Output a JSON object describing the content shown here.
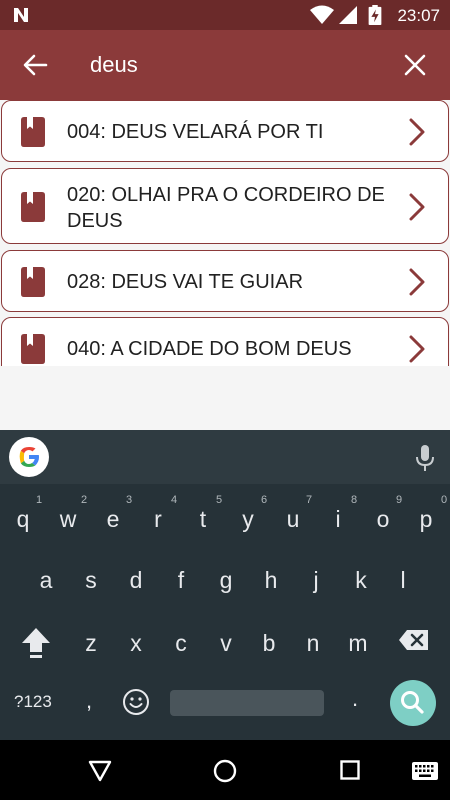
{
  "status_bar": {
    "time": "23:07",
    "icons": [
      "n-notification-icon",
      "wifi-icon",
      "signal-icon",
      "battery-charging-icon"
    ]
  },
  "app_bar": {
    "back_icon": "arrow-left-icon",
    "query": "deus",
    "clear_icon": "close-icon"
  },
  "results": [
    {
      "title": "004: DEUS VELARÁ POR TI"
    },
    {
      "title": "020: OLHAI PRA O CORDEIRO DE DEUS"
    },
    {
      "title": "028: DEUS VAI TE GUIAR"
    },
    {
      "title": "040: A CIDADE DO BOM DEUS"
    }
  ],
  "keyboard": {
    "row1": [
      "q",
      "w",
      "e",
      "r",
      "t",
      "y",
      "u",
      "i",
      "o",
      "p"
    ],
    "row1_hints": [
      "",
      "1",
      "2",
      "3",
      "4",
      "5",
      "6",
      "7",
      "8",
      "9",
      "0"
    ],
    "row2": [
      "a",
      "s",
      "d",
      "f",
      "g",
      "h",
      "j",
      "k",
      "l"
    ],
    "row3": [
      "z",
      "x",
      "c",
      "v",
      "b",
      "n",
      "m"
    ],
    "symbols_label": "?123",
    "comma": ",",
    "period": "."
  },
  "colors": {
    "status_bar": "#6b2a2a",
    "app_bar": "#8b3a3a",
    "accent": "#8b3a3a",
    "keyboard_bg": "#263238",
    "search_key": "#7ecfc5"
  }
}
